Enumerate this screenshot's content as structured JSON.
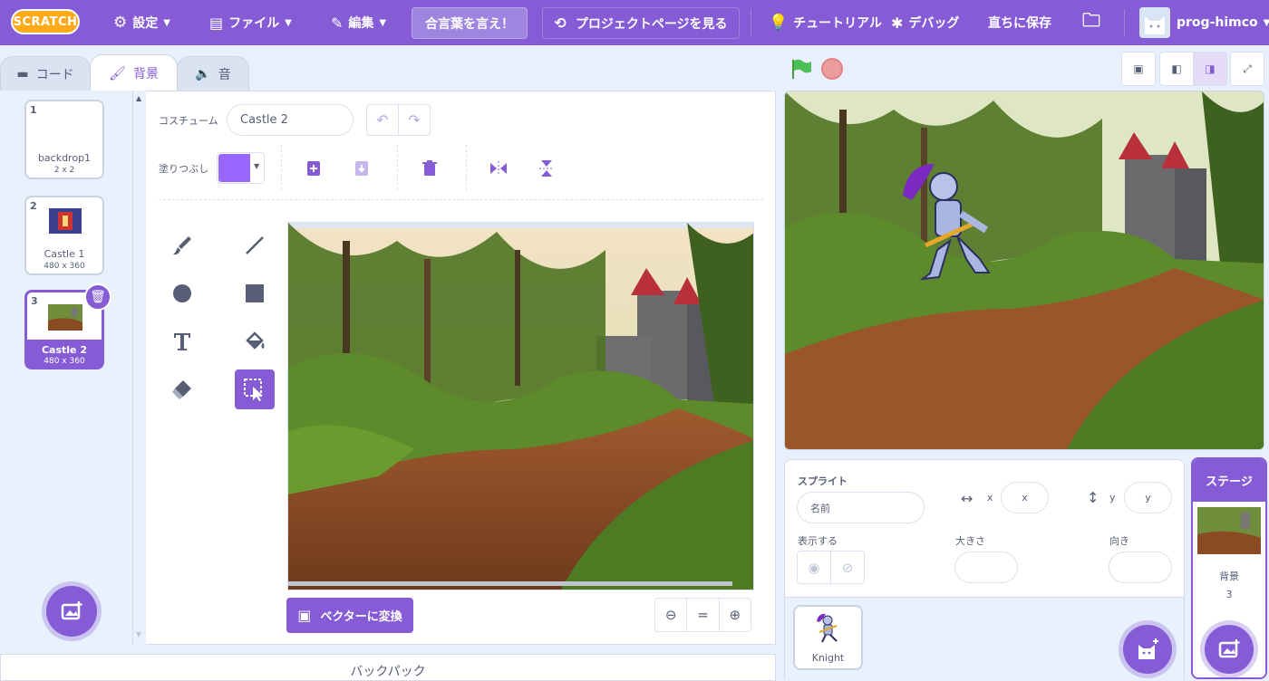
{
  "menubar": {
    "logo_text": "SCRATCH",
    "settings": "設定",
    "file": "ファイル",
    "edit": "編集",
    "project_title": "合言葉を言え！",
    "see_project_page": "プロジェクトページを見る",
    "tutorials": "チュートリアル",
    "debug": "デバッグ",
    "save_now": "直ちに保存",
    "username": "prog-himco",
    "accent": "#855cd6"
  },
  "tabs": {
    "code": "コード",
    "backdrops": "背景",
    "sounds": "音"
  },
  "backdrops": [
    {
      "num": "1",
      "name": "backdrop1",
      "size": "2 x 2"
    },
    {
      "num": "2",
      "name": "Castle 1",
      "size": "480 x 360"
    },
    {
      "num": "3",
      "name": "Castle 2",
      "size": "480 x 360"
    }
  ],
  "paint": {
    "costume_label": "コスチューム",
    "costume_name": "Castle 2",
    "fill_label": "塗りつぶし",
    "fill_color": "#9966ff",
    "convert_button": "ベクターに変換",
    "zoom_reset": "="
  },
  "backpack_label": "バックパック",
  "sprite_info": {
    "sprite_label": "スプライト",
    "name_placeholder": "名前",
    "x_label": "x",
    "x_placeholder": "x",
    "y_label": "y",
    "y_placeholder": "y",
    "show_label": "表示する",
    "size_label": "大きさ",
    "direction_label": "向き"
  },
  "sprites": [
    {
      "name": "Knight"
    }
  ],
  "stage_panel": {
    "title": "ステージ",
    "backdrops_label": "背景",
    "backdrop_count": "3"
  }
}
